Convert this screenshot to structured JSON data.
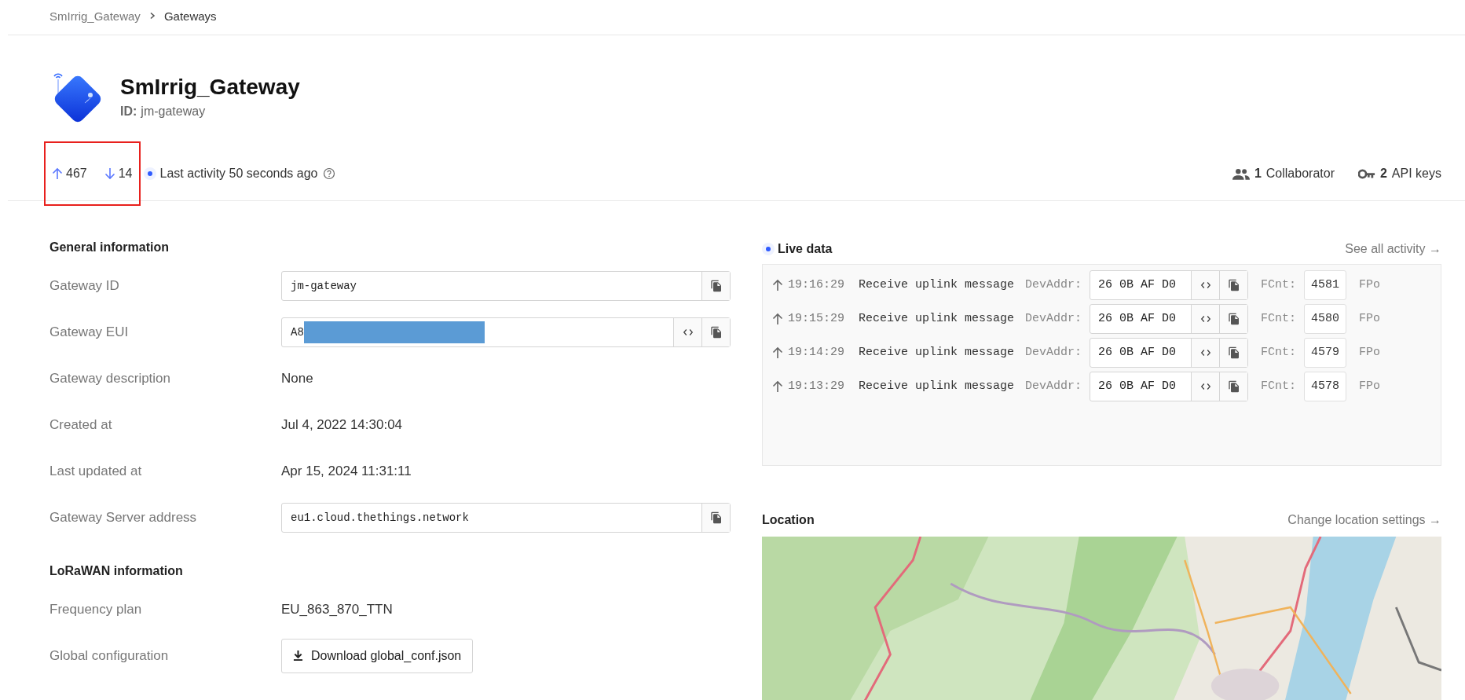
{
  "breadcrumbs": [
    {
      "label": "SmIrrig_Gateway",
      "current": false
    },
    {
      "label": "Gateways",
      "current": true
    }
  ],
  "header": {
    "title": "SmIrrig_Gateway",
    "id_label": "ID:",
    "id_value": "jm-gateway"
  },
  "stats": {
    "uplink_count": "467",
    "downlink_count": "14",
    "activity": "Last activity 50 seconds ago",
    "collaborators_count": "1",
    "collaborators_label": "Collaborator",
    "api_keys_count": "2",
    "api_keys_label": "API keys"
  },
  "general_information": {
    "title": "General information",
    "rows": [
      {
        "kind": "field",
        "label": "Gateway ID",
        "value": "jm-gateway",
        "redacted": false,
        "toggle": false
      },
      {
        "kind": "field",
        "label": "Gateway EUI",
        "value": "A8",
        "redacted": true,
        "toggle": true
      },
      {
        "kind": "text",
        "label": "Gateway description",
        "value": "None"
      },
      {
        "kind": "text",
        "label": "Created at",
        "value": "Jul 4, 2022 14:30:04"
      },
      {
        "kind": "text",
        "label": "Last updated at",
        "value": "Apr 15, 2024 11:31:11"
      },
      {
        "kind": "field",
        "label": "Gateway Server address",
        "value": "eu1.cloud.thethings.network",
        "redacted": false,
        "toggle": false
      }
    ]
  },
  "lorawan_information": {
    "title": "LoRaWAN information",
    "rows": [
      {
        "kind": "text",
        "label": "Frequency plan",
        "value": "EU_863_870_TTN"
      },
      {
        "kind": "button",
        "label": "Global configuration",
        "value": "Download global_conf.json"
      }
    ]
  },
  "live_data": {
    "title": "Live data",
    "link": "See all activity →",
    "events": [
      {
        "time": "19:16:29",
        "message": "Receive uplink message",
        "devaddr_label": "DevAddr:",
        "devaddr": "26 0B AF D0",
        "fcnt_label": "FCnt:",
        "fcnt": "4581",
        "next_label": "FPo"
      },
      {
        "time": "19:15:29",
        "message": "Receive uplink message",
        "devaddr_label": "DevAddr:",
        "devaddr": "26 0B AF D0",
        "fcnt_label": "FCnt:",
        "fcnt": "4580",
        "next_label": "FPo"
      },
      {
        "time": "19:14:29",
        "message": "Receive uplink message",
        "devaddr_label": "DevAddr:",
        "devaddr": "26 0B AF D0",
        "fcnt_label": "FCnt:",
        "fcnt": "4579",
        "next_label": "FPo"
      },
      {
        "time": "19:13:29",
        "message": "Receive uplink message",
        "devaddr_label": "DevAddr:",
        "devaddr": "26 0B AF D0",
        "fcnt_label": "FCnt:",
        "fcnt": "4578",
        "next_label": "FPo"
      }
    ]
  },
  "location": {
    "title": "Location",
    "link": "Change location settings →"
  }
}
